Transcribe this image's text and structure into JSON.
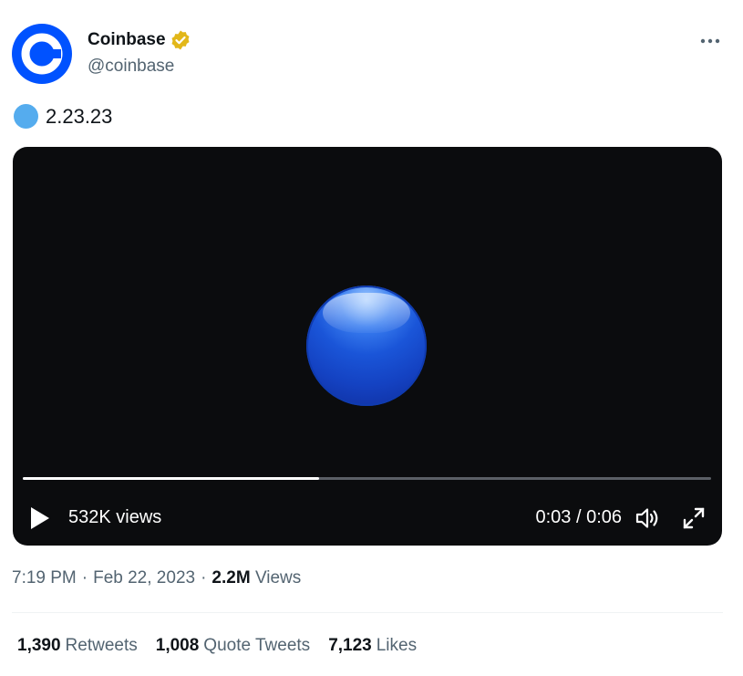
{
  "author": {
    "display_name": "Coinbase",
    "handle": "@coinbase",
    "verified": true
  },
  "tweet": {
    "emoji": "blue-circle",
    "text": "2.23.23"
  },
  "video": {
    "views": "532K views",
    "time": "0:03 / 0:06",
    "progress": 0.43
  },
  "meta": {
    "time": "7:19 PM",
    "separator1": "·",
    "date": "Feb 22, 2023",
    "separator2": "·",
    "views_count": "2.2M",
    "views_label": "Views"
  },
  "stats": {
    "retweets_count": "1,390",
    "retweets_label": "Retweets",
    "quotes_count": "1,008",
    "quotes_label": "Quote Tweets",
    "likes_count": "7,123",
    "likes_label": "Likes"
  },
  "colors": {
    "brand_blue": "#0052ff",
    "verified_gold": "#e2b719",
    "secondary_text": "#536471"
  }
}
